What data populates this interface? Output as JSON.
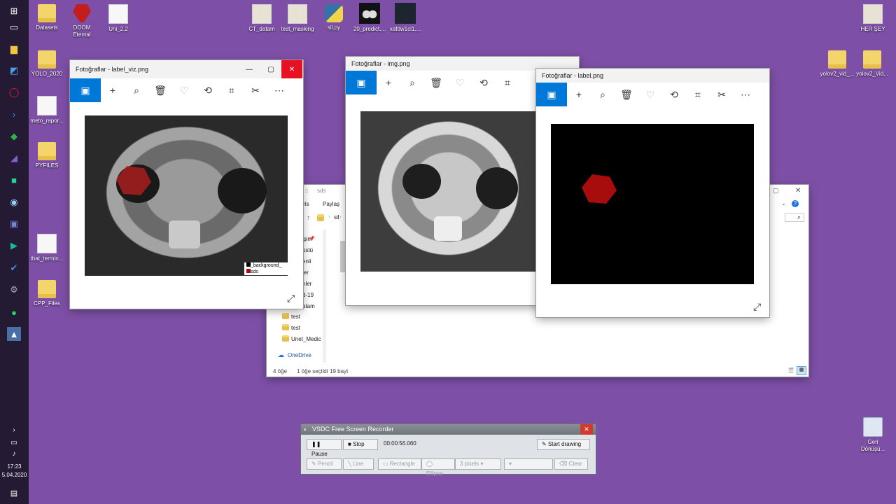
{
  "taskbar": {
    "clock_time": "17:23",
    "clock_date": "5.04.2020",
    "icons": [
      "windows-icon",
      "task-view-icon",
      "file-explorer-icon",
      "store-icon",
      "opera-icon",
      "powershell-icon",
      "tag-icon",
      "visual-studio-icon",
      "pycharm-icon",
      "steam-icon",
      "discord-icon",
      "media-icon",
      "todo-icon",
      "settings-icon",
      "spotify-icon",
      "photos-icon"
    ]
  },
  "desktop": {
    "icons_top": [
      {
        "label": "Datasets",
        "kind": "folder"
      },
      {
        "label": "DOOM\nEternal",
        "kind": "game"
      },
      {
        "label": "Uni_2.2",
        "kind": "folder"
      },
      {
        "label": "CT_datam",
        "kind": "file"
      },
      {
        "label": "test_masking",
        "kind": "file"
      },
      {
        "label": "sil.py",
        "kind": "python"
      },
      {
        "label": "20_predict....",
        "kind": "image"
      },
      {
        "label": "xafdw1cl1....",
        "kind": "image"
      },
      {
        "label": "HER ŞEY",
        "kind": "file"
      }
    ],
    "icons_left": [
      {
        "label": "YOLO_2020",
        "kind": "folder"
      },
      {
        "label": "meto_rapor...",
        "kind": "file"
      },
      {
        "label": "PYFILES",
        "kind": "folder"
      },
      {
        "label": "that_termin...",
        "kind": "file"
      },
      {
        "label": "CPP_Files",
        "kind": "folder"
      }
    ],
    "icons_right": [
      {
        "label": "yolov2_vid_...",
        "kind": "folder"
      },
      {
        "label": "yolov2_Vid...",
        "kind": "folder"
      },
      {
        "label": "Geri\nDönüşü...",
        "kind": "recycle"
      }
    ]
  },
  "photos_windows": [
    {
      "title": "Fotoğraflar - label_viz.png",
      "legend": [
        "_background_",
        "sds"
      ]
    },
    {
      "title": "Fotoğraflar - img.png"
    },
    {
      "title": "Fotoğraflar - label.png"
    }
  ],
  "explorer": {
    "title": "sds",
    "menu": [
      "ris",
      "Paylaş"
    ],
    "path": "sil",
    "sidebar": [
      "işim",
      "üstü",
      "enli",
      "ler",
      "nler",
      "d-19",
      "atam",
      "test",
      "test",
      "Unet_Medic"
    ],
    "onedrive": "OneDrive",
    "status_items": "4 öğe",
    "status_selected": "1 öğe seçildi",
    "status_size": "19 bayt"
  },
  "recorder": {
    "title": "VSDC Free Screen Recorder",
    "pause": "Pause",
    "stop": "Stop",
    "time": "00:00:56.060",
    "start_drawing": "Start drawing",
    "pencil": "Pencil",
    "line": "Line",
    "rectangle": "Rectangle",
    "ellipse": "Ellipse",
    "pixels": "3 pixels",
    "clear": "Clear"
  },
  "colors": {
    "desktop": "#7d4fa6",
    "accent": "#0078d7",
    "close": "#e81123",
    "mask": "#a80d0d"
  }
}
